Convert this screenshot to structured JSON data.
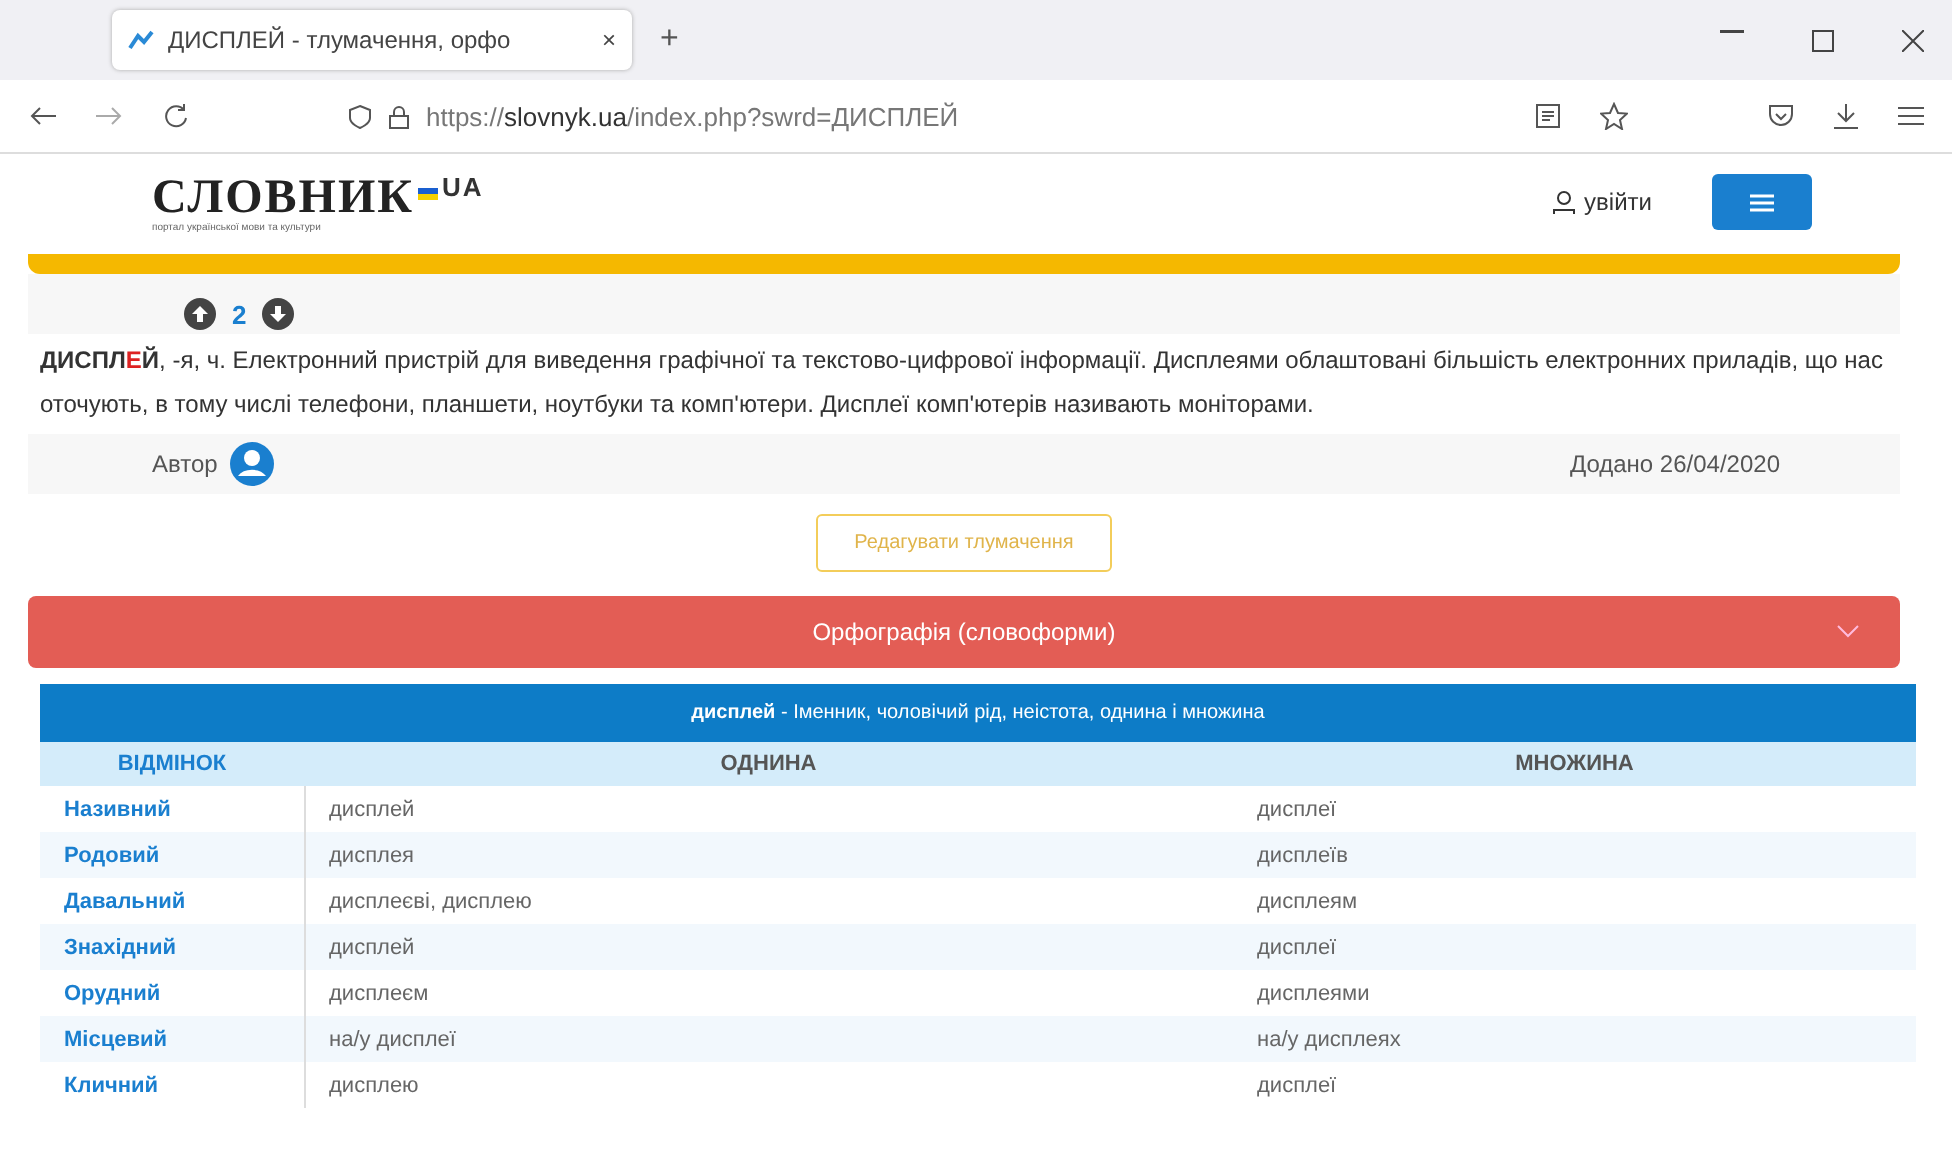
{
  "browser": {
    "tab_title": "ДИСПЛЕЙ - тлумачення, орфо",
    "tab_close": "×",
    "new_tab": "+",
    "url_prefix": "https://",
    "url_host": "slovnyk.ua",
    "url_path": "/index.php?swrd=ДИСПЛЕЙ"
  },
  "header": {
    "logo": "СЛОВНИК",
    "logo_suffix": "UA",
    "tagline": "портал української мови та культури",
    "login": "увійти"
  },
  "votes": {
    "count": "2"
  },
  "definition": {
    "head_before": "ДИСПЛ",
    "head_stress": "Е",
    "head_after": "Й",
    "text": ", -я, ч. Електронний пристрій для виведення графічної та текстово-цифрової інформації. Дисплеями облаштовані більшість електронних приладів, що нас оточують, в тому числі телефони, планшети, ноутбуки та комп'ютери. Дисплеї комп'ютерів називають моніторами."
  },
  "author_label": "Автор",
  "added": "Додано 26/04/2020",
  "edit_button": "Редагувати тлумачення",
  "accordion": {
    "title": "Орфографія (словоформи)",
    "expanded": true
  },
  "table": {
    "caption_word": "дисплей",
    "caption_rest": " - Іменник, чоловічий рід, неістота, однина і множина",
    "columns": [
      "ВІДМІНОК",
      "ОДНИНА",
      "МНОЖИНА"
    ],
    "rows": [
      [
        "Називний",
        "дисплей",
        "дисплеї"
      ],
      [
        "Родовий",
        "дисплея",
        "дисплеїв"
      ],
      [
        "Давальний",
        "дисплеєві, дисплею",
        "дисплеям"
      ],
      [
        "Знахідний",
        "дисплей",
        "дисплеї"
      ],
      [
        "Орудний",
        "дисплеєм",
        "дисплеями"
      ],
      [
        "Місцевий",
        "на/у дисплеї",
        "на/у дисплеях"
      ],
      [
        "Кличний",
        "дисплею",
        "дисплеї"
      ]
    ]
  }
}
